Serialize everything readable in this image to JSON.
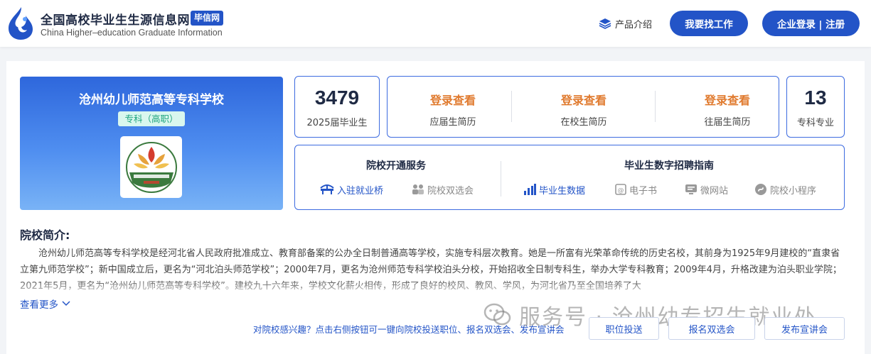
{
  "header": {
    "logo_cn": "全国高校毕业生生源信息网",
    "logo_badge": "毕信网",
    "logo_en": "China Higher–education Graduate Information",
    "product_intro": "产品介绍",
    "find_job": "我要找工作",
    "company_login": "企业登录 | 注册"
  },
  "school": {
    "name": "沧州幼儿师范高等专科学校",
    "level_tag": "专科（高职）"
  },
  "stats": {
    "graduates_value": "3479",
    "graduates_label": "2025届毕业生",
    "majors_value": "13",
    "majors_label": "专科专业"
  },
  "resume_views": [
    {
      "title": "登录查看",
      "label": "应届生简历"
    },
    {
      "title": "登录查看",
      "label": "在校生简历"
    },
    {
      "title": "登录查看",
      "label": "往届生简历"
    }
  ],
  "services": {
    "opened_title": "院校开通服务",
    "opened_items": [
      {
        "label": "入驻就业桥",
        "icon": "bridge-icon",
        "active": true
      },
      {
        "label": "院校双选会",
        "icon": "people-icon",
        "active": false
      }
    ],
    "guide_title": "毕业生数字招聘指南",
    "guide_items": [
      {
        "label": "毕业生数据",
        "icon": "bar-chart-icon",
        "active": true
      },
      {
        "label": "电子书",
        "icon": "ebook-icon",
        "active": false
      },
      {
        "label": "微网站",
        "icon": "website-icon",
        "active": false
      },
      {
        "label": "院校小程序",
        "icon": "mini-program-icon",
        "active": false
      }
    ]
  },
  "intro": {
    "title": "院校简介:",
    "text": "沧州幼儿师范高等专科学校是经河北省人民政府批准成立、教育部备案的公办全日制普通高等学校，实施专科层次教育。她是一所富有光荣革命传统的历史名校，其前身为1925年9月建校的“直隶省立第九师范学校”；新中国成立后，更名为“河北泊头师范学校”；2000年7月，更名为沧州师范专科学校泊头分校，开始招收全日制专科生，举办大学专科教育；2009年4月，升格改建为泊头职业学院；2021年5月，更名为“沧州幼儿师范高等专科学校”。建校九十六年来，学校文化薪火相传，形成了良好的校风、教风、学风，为河北省乃至全国培养了大",
    "see_more": "查看更多"
  },
  "cta": {
    "text": "对院校感兴趣？点击右侧按钮可一键向院校投送职位、报名双选会、发布宣讲会",
    "post_job": "职位投送",
    "join_fair": "报名双选会",
    "publish_talk": "发布宣讲会"
  },
  "watermark": "服务号 · 沧州幼专招生就业处",
  "colors": {
    "brand_blue": "#2354c7",
    "accent_orange": "#e07a2e",
    "tag_green": "#1fa57f"
  }
}
